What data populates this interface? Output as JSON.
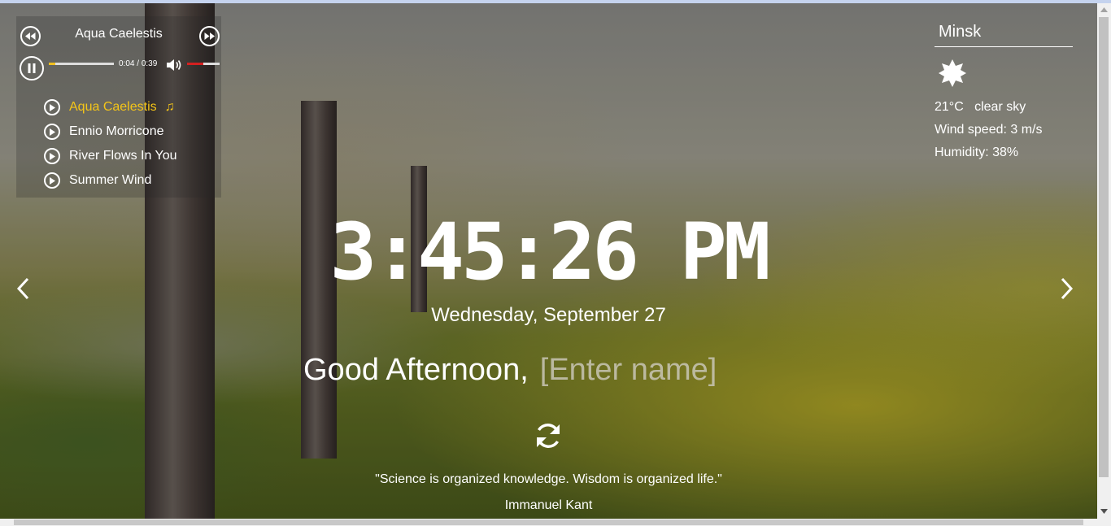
{
  "player": {
    "current_title": "Aqua Caelestis",
    "current_time": "0:04",
    "duration": "0:39",
    "time_separator": " / ",
    "progress_fraction": 0.1,
    "volume_fraction": 0.5,
    "playlist": [
      {
        "label": "Aqua Caelestis",
        "active": true
      },
      {
        "label": "Ennio Morricone",
        "active": false
      },
      {
        "label": "River Flows In You",
        "active": false
      },
      {
        "label": "Summer Wind",
        "active": false
      }
    ]
  },
  "weather": {
    "city": "Minsk",
    "icon": "sun-icon",
    "temperature": "21°C",
    "description": "clear sky",
    "wind": "Wind speed: 3 m/s",
    "humidity": "Humidity: 38%"
  },
  "clock": {
    "hours": "3",
    "minutes": "45",
    "seconds": "26",
    "period": "PM",
    "separator": ":"
  },
  "date": "Wednesday, September 27",
  "greeting": {
    "text": "Good Afternoon,",
    "name_placeholder": "[Enter name]"
  },
  "quote": {
    "text": "\"Science is organized knowledge. Wisdom is organized life.\"",
    "author": "Immanuel Kant"
  },
  "colors": {
    "accent": "#f5c518",
    "volume": "#d42020",
    "text": "#ffffff"
  }
}
